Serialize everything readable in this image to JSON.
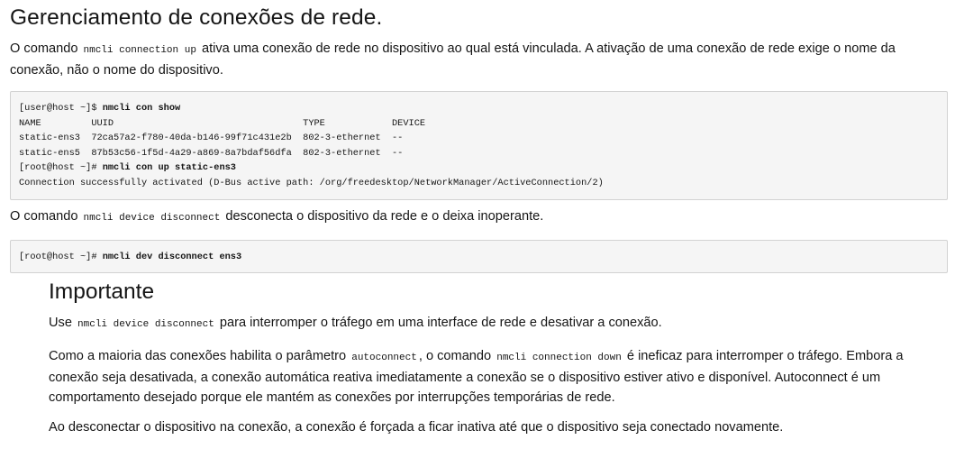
{
  "section": {
    "title": "Gerenciamento de conexões de rede."
  },
  "para1": {
    "text_before": "O comando ",
    "code": "nmcli connection up",
    "text_after": " ativa uma conexão de rede no dispositivo ao qual está vinculada. A ativação de uma conexão de rede exige o nome da conexão, não o nome do dispositivo."
  },
  "code_block_1": {
    "lines": [
      {
        "prompt": "[user@host ~]$ ",
        "command": "nmcli con show"
      },
      {
        "output": "NAME         UUID                                  TYPE            DEVICE"
      },
      {
        "output": "static-ens3  72ca57a2-f780-40da-b146-99f71c431e2b  802-3-ethernet  --"
      },
      {
        "output": "static-ens5  87b53c56-1f5d-4a29-a869-8a7bdaf56dfa  802-3-ethernet  --"
      },
      {
        "prompt": "[root@host ~]# ",
        "command": "nmcli con up static-ens3"
      },
      {
        "output": "Connection successfully activated (D-Bus active path: /org/freedesktop/NetworkManager/ActiveConnection/2)"
      }
    ]
  },
  "para2": {
    "text_before": "O comando ",
    "code": "nmcli device disconnect",
    "text_after": " desconecta o dispositivo da rede e o deixa inoperante."
  },
  "code_block_2": {
    "prompt": "[root@host ~]# ",
    "command": "nmcli dev disconnect ens3"
  },
  "important": {
    "title": "Importante",
    "p1": {
      "text_before": "Use ",
      "code": "nmcli device disconnect",
      "text_after": " para interromper o tráfego em uma interface de rede e desativar a conexão."
    },
    "p2": {
      "text_before": "Como a maioria das conexões habilita o parâmetro ",
      "code1": "autoconnect",
      "text_middle": ", o comando ",
      "code2": "nmcli connection down",
      "text_after": " é ineficaz para interromper o tráfego. Embora a conexão seja desativada, a conexão automática reativa imediatamente a conexão se o dispositivo estiver ativo e disponível. Autoconnect é um comportamento desejado porque ele mantém as conexões por interrupções temporárias de rede."
    },
    "p3": {
      "text": "Ao desconectar o dispositivo na conexão, a conexão é forçada a ficar inativa até que o dispositivo seja conectado novamente."
    }
  }
}
